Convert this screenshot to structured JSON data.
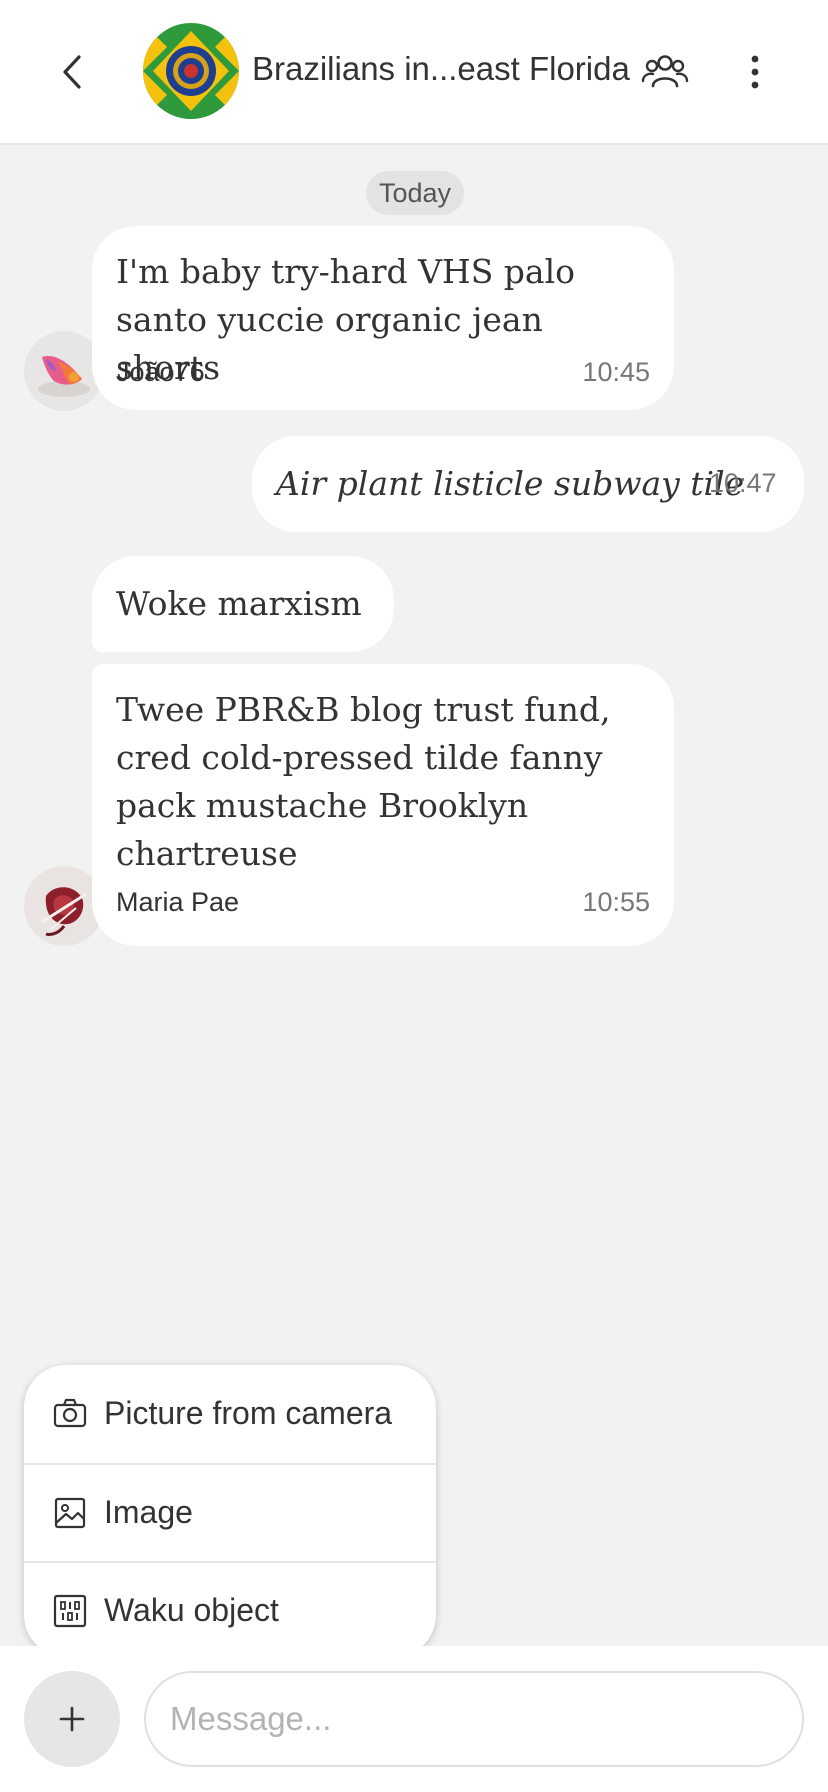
{
  "header": {
    "title": "Brazilians in...east Florida",
    "back_icon": "chevron-left-icon",
    "members_icon": "group-icon",
    "more_icon": "more-vertical-icon"
  },
  "chat": {
    "date_label": "Today",
    "messages": [
      {
        "text": "I'm baby try-hard VHS palo santo yuccie organic jean shorts",
        "author": "João76",
        "time": "10:45",
        "own": false
      },
      {
        "text": "Air plant listicle subway tile",
        "time": "10:47",
        "own": true
      },
      {
        "text": "Woke marxism",
        "own": false
      },
      {
        "text": "Twee PBR&B blog trust fund, cred cold-pressed tilde fanny pack mustache Brooklyn chartreuse",
        "author": "Maria Pae",
        "time": "10:55",
        "own": false
      }
    ]
  },
  "attach_menu": {
    "items": [
      {
        "label": "Picture from camera",
        "icon": "camera-icon"
      },
      {
        "label": "Image",
        "icon": "image-icon"
      },
      {
        "label": "Waku object",
        "icon": "waku-object-icon"
      }
    ]
  },
  "composer": {
    "placeholder": "Message...",
    "value": ""
  },
  "colors": {
    "background": "#f2f2f2",
    "bubble": "#ffffff",
    "flag_green": "#2e9a3c",
    "flag_yellow": "#f4c20d",
    "flag_blue": "#1e3f8f"
  }
}
